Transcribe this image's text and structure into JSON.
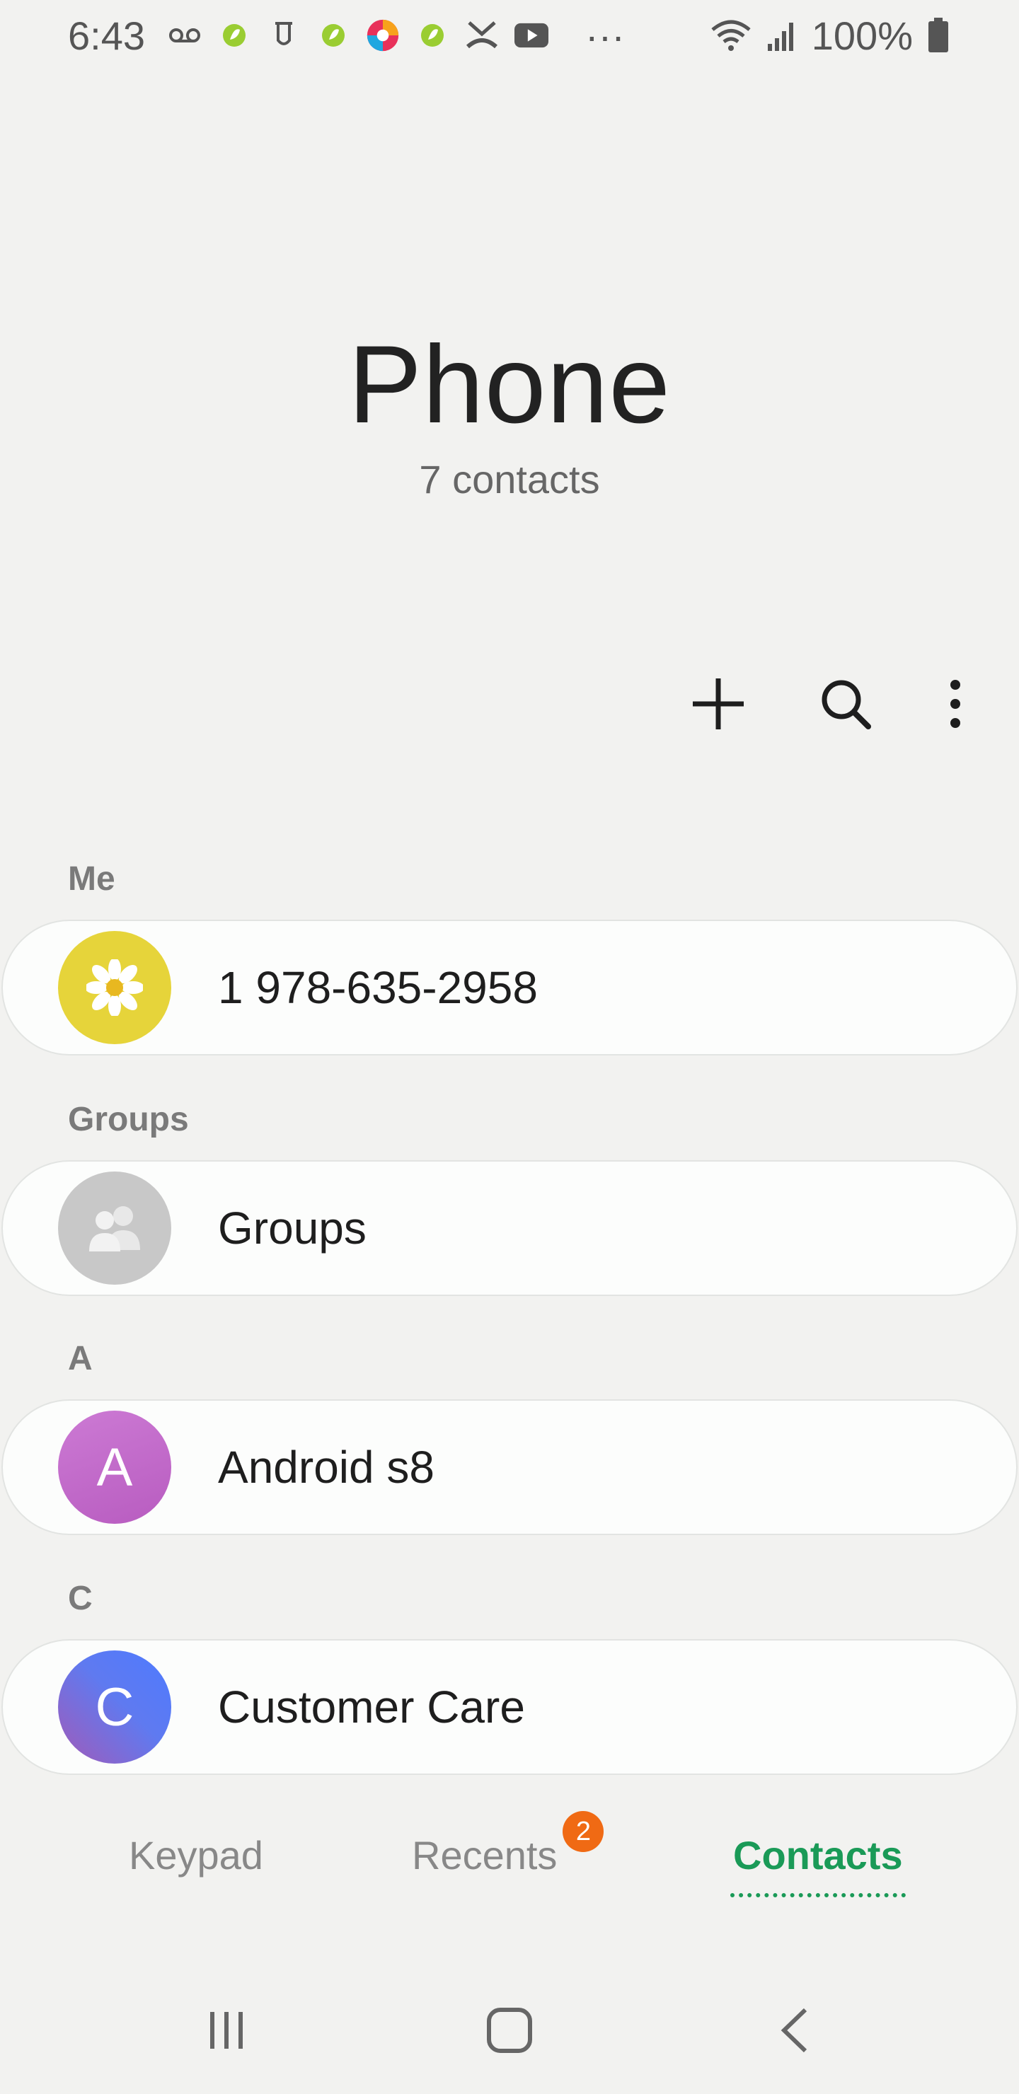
{
  "status_bar": {
    "time": "6:43",
    "icons": [
      "voicemail-icon",
      "leaf-icon",
      "tmobile-icon",
      "leaf-icon",
      "chrome-like-icon",
      "leaf-icon",
      "missed-call-icon",
      "youtube-icon",
      "more-dots-icon"
    ],
    "more": "···",
    "battery": "100%"
  },
  "header": {
    "title": "Phone",
    "subtitle": "7 contacts"
  },
  "actions": [
    "add-icon",
    "search-icon",
    "more-vert-icon"
  ],
  "sections": [
    {
      "label": "Me",
      "item": "1 978-635-2958"
    },
    {
      "label": "Groups",
      "item": "Groups"
    },
    {
      "label": "A",
      "item": "Android s8",
      "initial": "A"
    },
    {
      "label": "C",
      "item": "Customer Care",
      "initial": "C"
    }
  ],
  "tabs": {
    "keypad": "Keypad",
    "recents": "Recents",
    "recents_badge": "2",
    "contacts": "Contacts"
  },
  "colors": {
    "accent": "#1a9a57",
    "badge": "#f06a14",
    "avatar_me": "#e6d43a",
    "avatar_groups": "#c8c8c8",
    "avatar_a": "#c06ac8",
    "avatar_c": "#5a7af8"
  }
}
